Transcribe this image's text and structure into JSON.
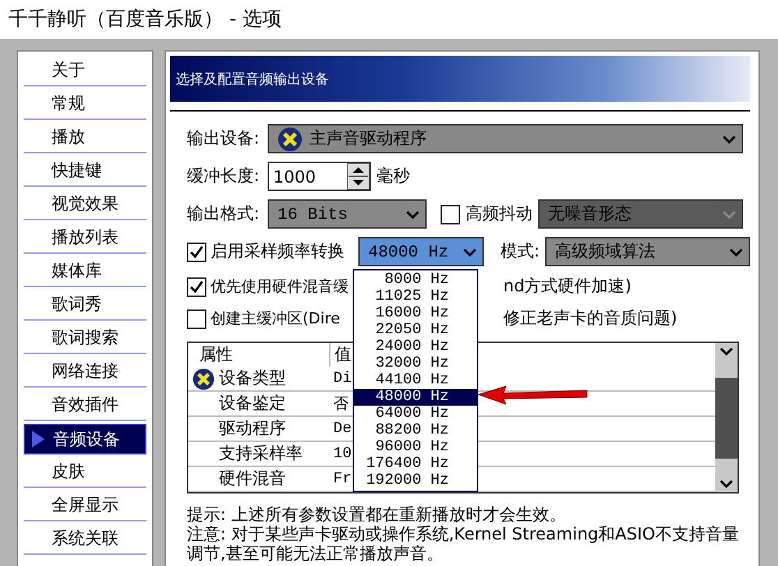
{
  "window": {
    "title": "千千静听（百度音乐版） - 选项"
  },
  "sidebar": {
    "items": [
      {
        "label": "关于",
        "selected": false
      },
      {
        "label": "常规",
        "selected": false
      },
      {
        "label": "播放",
        "selected": false
      },
      {
        "label": "快捷键",
        "selected": false
      },
      {
        "label": "视觉效果",
        "selected": false
      },
      {
        "label": "播放列表",
        "selected": false
      },
      {
        "label": "媒体库",
        "selected": false
      },
      {
        "label": "歌词秀",
        "selected": false
      },
      {
        "label": "歌词搜索",
        "selected": false
      },
      {
        "label": "网络连接",
        "selected": false
      },
      {
        "label": "音效插件",
        "selected": false
      },
      {
        "label": "音频设备",
        "selected": true
      },
      {
        "label": "皮肤",
        "selected": false
      },
      {
        "label": "全屏显示",
        "selected": false
      },
      {
        "label": "系统关联",
        "selected": false
      }
    ]
  },
  "header": {
    "title": "选择及配置音频输出设备"
  },
  "output_device": {
    "label": "输出设备:",
    "value": "主声音驱动程序"
  },
  "buffer": {
    "label": "缓冲长度:",
    "value": "1000",
    "unit": "毫秒"
  },
  "output_format": {
    "label": "输出格式:",
    "value": "16 Bits"
  },
  "dither": {
    "label": "高频抖动",
    "checked": false,
    "value": "无噪音形态",
    "disabled": true
  },
  "resample": {
    "label": "启用采样频率转换",
    "checked": true,
    "value": "48000 Hz",
    "open": true,
    "mode_label": "模式:",
    "mode_value": "高级频域算法"
  },
  "hw_mix": {
    "label_start": "优先使用硬件混音缓",
    "label_end": "nd方式硬件加速)",
    "checked": true
  },
  "primary_buffer": {
    "label_start": "创建主缓冲区(Dire",
    "label_end": "修正老声卡的音质问题)",
    "checked": false
  },
  "table": {
    "columns": [
      "属性",
      "值"
    ],
    "rows": [
      {
        "name": "设备类型",
        "value": "Di",
        "flagged": true
      },
      {
        "name": "设备鉴定",
        "value": "否",
        "flagged": false
      },
      {
        "name": "驱动程序",
        "value": "De",
        "flagged": false
      },
      {
        "name": "支持采样率",
        "value": "10",
        "flagged": false
      },
      {
        "name": "硬件混音",
        "value": "Fr",
        "flagged": false
      }
    ]
  },
  "dropdown": {
    "options": [
      {
        "label": "8000 Hz",
        "selected": false
      },
      {
        "label": "11025 Hz",
        "selected": false
      },
      {
        "label": "16000 Hz",
        "selected": false
      },
      {
        "label": "22050 Hz",
        "selected": false
      },
      {
        "label": "24000 Hz",
        "selected": false
      },
      {
        "label": "32000 Hz",
        "selected": false
      },
      {
        "label": "44100 Hz",
        "selected": false
      },
      {
        "label": "48000 Hz",
        "selected": true
      },
      {
        "label": "64000 Hz",
        "selected": false
      },
      {
        "label": "88200 Hz",
        "selected": false
      },
      {
        "label": "96000 Hz",
        "selected": false
      },
      {
        "label": "176400 Hz",
        "selected": false
      },
      {
        "label": "192000 Hz",
        "selected": false
      }
    ]
  },
  "notes": [
    "提示: 上述所有参数设置都在重新播放时才会生效。",
    "注意: 对于某些声卡驱动或操作系统,Kernel Streaming和ASIO不支持音量调节,甚至可能无法正常播放声音。"
  ]
}
